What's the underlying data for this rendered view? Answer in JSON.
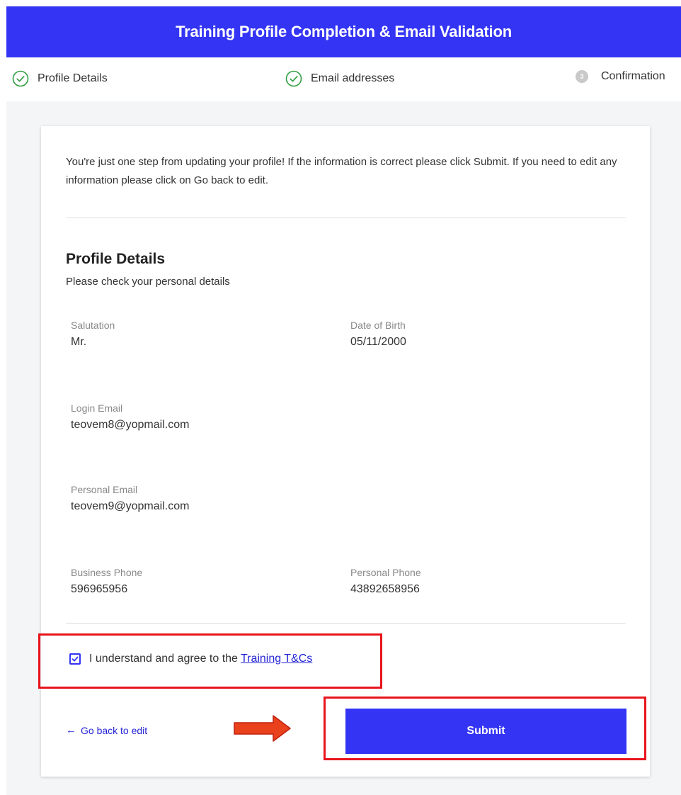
{
  "header": {
    "title": "Training Profile Completion & Email Validation"
  },
  "stepper": {
    "steps": [
      {
        "label": "Profile Details",
        "state": "completed",
        "icon": "check-circle-icon"
      },
      {
        "label": "Email addresses",
        "state": "completed",
        "icon": "check-circle-icon"
      },
      {
        "label": "Confirmation",
        "state": "current",
        "number": "3"
      }
    ]
  },
  "intro_text": "You're just one step from updating your profile! If the information is correct please click Submit. If you need to edit any information please click on Go back to edit.",
  "profile": {
    "title": "Profile Details",
    "subtitle": "Please check your personal details",
    "fields": {
      "salutation": {
        "label": "Salutation",
        "value": "Mr."
      },
      "dob": {
        "label": "Date of Birth",
        "value": "05/11/2000"
      },
      "login_email": {
        "label": "Login Email",
        "value": "teovem8@yopmail.com"
      },
      "personal_email": {
        "label": "Personal Email",
        "value": "teovem9@yopmail.com"
      },
      "business_phone": {
        "label": "Business Phone",
        "value": "596965956"
      },
      "personal_phone": {
        "label": "Personal Phone",
        "value": "43892658956"
      }
    }
  },
  "terms": {
    "checked": true,
    "text": "I understand and agree to the",
    "link": "Training T&Cs"
  },
  "actions": {
    "back_label": "Go back to edit",
    "submit_label": "Submit"
  },
  "colors": {
    "primary": "#3434f5",
    "link": "#2323d6",
    "success": "#2e9e3e",
    "annotation": "#e8141c",
    "page_bg": "#f4f5f7"
  }
}
